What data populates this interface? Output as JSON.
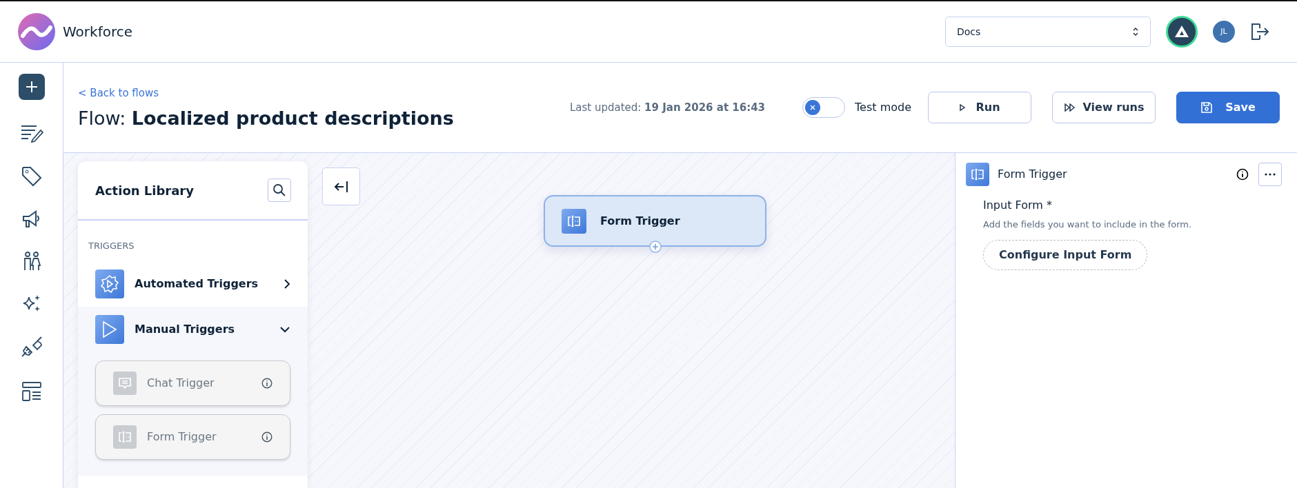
{
  "app": {
    "name": "Workforce"
  },
  "header": {
    "workspace_select": {
      "value": "Docs"
    },
    "avatar_initials": "JL"
  },
  "flow": {
    "back_link": "< Back to flows",
    "title": "Flow: **Localized product descriptions**",
    "last_updated": "Last updated: **19 Jan 2026 at 16:43**",
    "test_mode": {
      "label": "Test mode",
      "on": false
    },
    "buttons": [
      {
        "kind": "run",
        "label": "Run"
      },
      {
        "kind": "view",
        "label": "View runs"
      },
      {
        "kind": "save",
        "label": "Save"
      }
    ]
  },
  "action_library": {
    "title": "Action Library",
    "section": "TRIGGERS",
    "groups": [
      {
        "kind": "automated",
        "label": "Automated Triggers",
        "expanded": false
      },
      {
        "kind": "manual",
        "label": "Manual Triggers",
        "expanded": true,
        "children": [
          {
            "kind": "chat",
            "label": "Chat Trigger",
            "disabled": true
          },
          {
            "kind": "form",
            "label": "Form Trigger",
            "disabled": true
          }
        ]
      }
    ]
  },
  "canvas": {
    "nodes": [
      {
        "kind": "form",
        "label": "Form Trigger",
        "selected": true
      }
    ]
  },
  "details": {
    "title": "Form Trigger",
    "field_label": "Input Form *",
    "field_help": "Add the fields you want to include in the form.",
    "button": "Configure Input Form"
  }
}
